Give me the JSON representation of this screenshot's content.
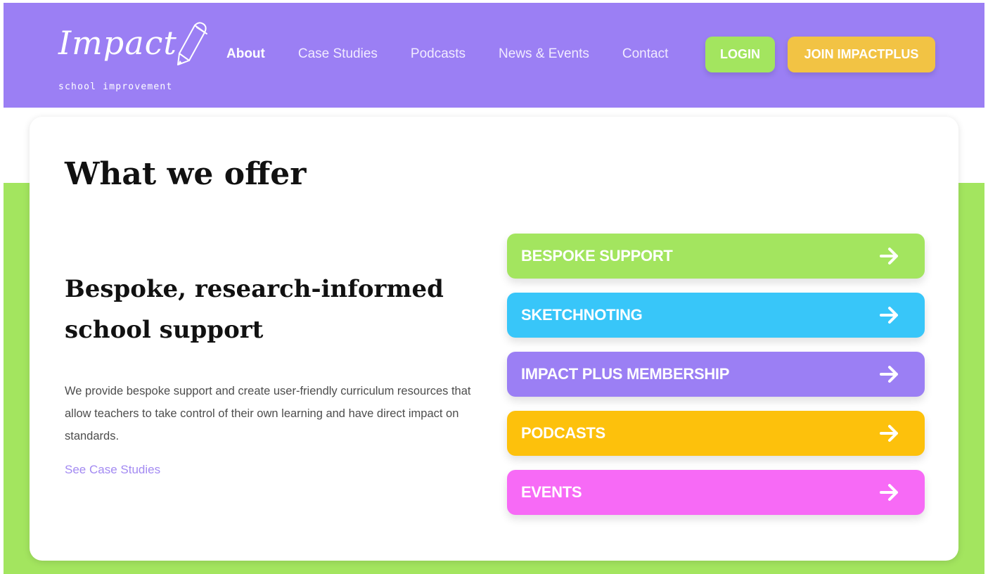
{
  "header": {
    "logo_text": "Impact",
    "logo_subtext": "school improvement",
    "nav": [
      {
        "label": "About",
        "active": true
      },
      {
        "label": "Case Studies",
        "active": false
      },
      {
        "label": "Podcasts",
        "active": false
      },
      {
        "label": "News & Events",
        "active": false
      },
      {
        "label": "Contact",
        "active": false
      }
    ],
    "login_label": "LOGIN",
    "join_label": "JOIN IMPACTPLUS"
  },
  "main": {
    "title": "What we offer",
    "section_heading": "Bespoke, research-informed school support",
    "description": "We provide bespoke support and create user-friendly curriculum resources that allow teachers to take control of their own learning and have direct impact on standards.",
    "link_label": "See Case Studies",
    "offers": [
      {
        "label": "BESPOKE SUPPORT",
        "color": "#a3e55f",
        "icon": "arrow-right-icon"
      },
      {
        "label": "SKETCHNOTING",
        "color": "#38c6f9",
        "icon": "arrow-right-icon"
      },
      {
        "label": "IMPACT PLUS MEMBERSHIP",
        "color": "#9b7ff4",
        "icon": "arrow-right-icon"
      },
      {
        "label": "PODCASTS",
        "color": "#fdc10c",
        "icon": "arrow-right-icon"
      },
      {
        "label": "EVENTS",
        "color": "#f76af6",
        "icon": "arrow-right-icon"
      }
    ]
  },
  "colors": {
    "header_bg": "#9b7ff4",
    "green_band": "#a3e55f",
    "login_bg": "#a3e55f",
    "join_bg": "#f2c344",
    "link": "#a38af2"
  }
}
